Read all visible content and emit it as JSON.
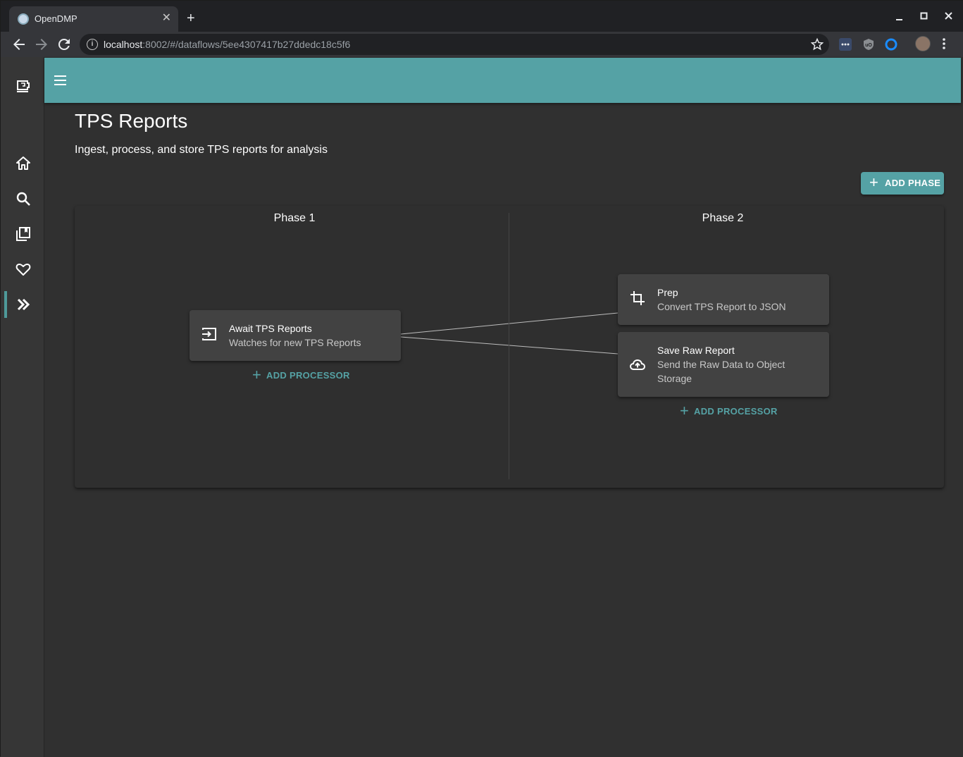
{
  "browser": {
    "tab_title": "OpenDMP",
    "tab_close": "✕",
    "new_tab": "+",
    "url_host": "localhost",
    "url_rest": ":8002/#/dataflows/5ee4307417b27ddedc18c5f6"
  },
  "colors": {
    "appbar": "#55a2a5",
    "accent": "#55a2a5",
    "background": "#303030",
    "card": "#424242"
  },
  "sidebar": {
    "items": [
      {
        "icon": "coffee-logo-icon"
      },
      {
        "icon": "home-icon"
      },
      {
        "icon": "search-icon"
      },
      {
        "icon": "collections-icon"
      },
      {
        "icon": "heart-icon"
      },
      {
        "icon": "chevron-double-right-icon",
        "active": true
      }
    ]
  },
  "page": {
    "title": "TPS Reports",
    "description": "Ingest, process, and store TPS reports for analysis",
    "add_phase_plus": "+",
    "add_phase_label": "ADD PHASE"
  },
  "phases": [
    {
      "title": "Phase 1",
      "processors": [
        {
          "name": "Await TPS Reports",
          "description": "Watches for new TPS Reports",
          "icon": "input-icon"
        }
      ],
      "add_processor_plus": "+",
      "add_processor_label": "ADD PROCESSOR"
    },
    {
      "title": "Phase 2",
      "processors": [
        {
          "name": "Prep",
          "description": "Convert TPS Report to JSON",
          "icon": "crop-icon"
        },
        {
          "name": "Save Raw Report",
          "description": "Send the Raw Data to Object Storage",
          "icon": "cloud-upload-icon"
        }
      ],
      "add_processor_plus": "+",
      "add_processor_label": "ADD PROCESSOR"
    }
  ]
}
